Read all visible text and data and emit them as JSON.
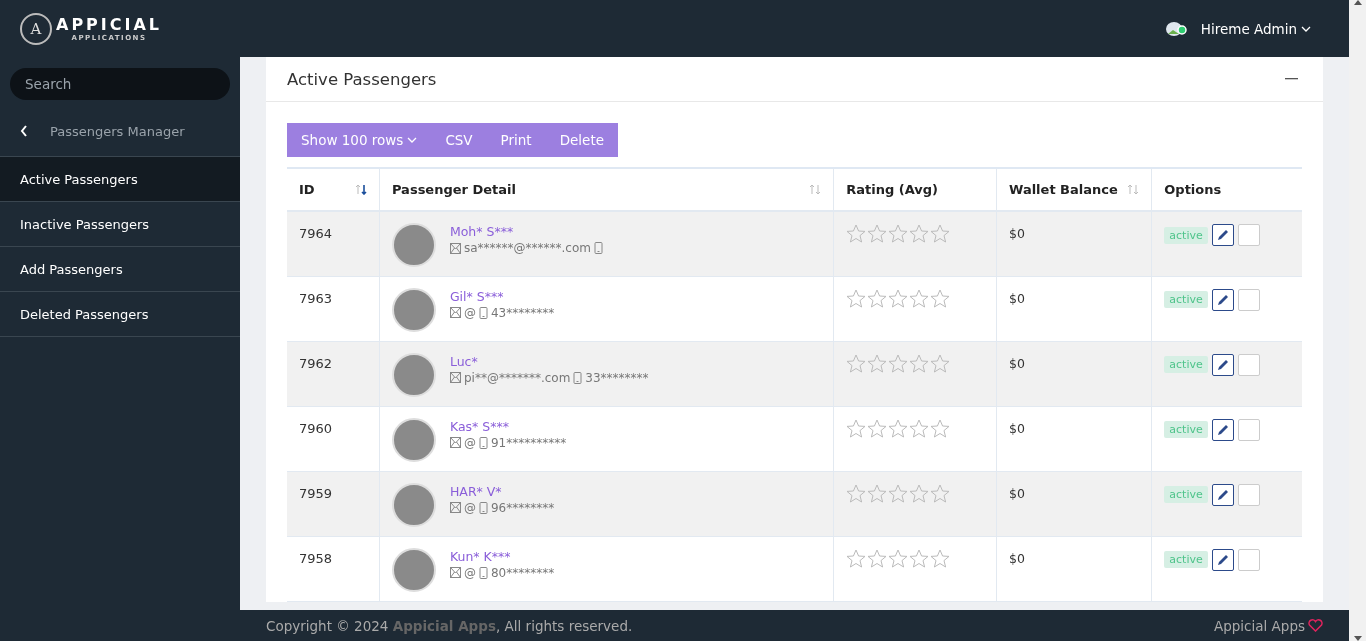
{
  "logo": {
    "mark": "A",
    "name": "APPICIAL",
    "tagline": "APPLICATIONS"
  },
  "user": {
    "name": "Hireme Admin"
  },
  "sidebar": {
    "search": {
      "placeholder": "Search"
    },
    "section": "Passengers Manager",
    "items": [
      {
        "label": "Active Passengers",
        "selected": true
      },
      {
        "label": "Inactive Passengers",
        "selected": false
      },
      {
        "label": "Add Passengers",
        "selected": false
      },
      {
        "label": "Deleted Passengers",
        "selected": false
      }
    ]
  },
  "card": {
    "title": "Active Passengers",
    "toolbar": [
      {
        "label": "Show 100 rows",
        "kind": "dropdown"
      },
      {
        "label": "CSV",
        "kind": "button"
      },
      {
        "label": "Print",
        "kind": "button"
      },
      {
        "label": "Delete",
        "kind": "button"
      }
    ]
  },
  "table": {
    "columns": [
      {
        "label": "ID",
        "sortable": true,
        "sorted": true
      },
      {
        "label": "Passenger Detail",
        "sortable": true,
        "sorted": false
      },
      {
        "label": "Rating (Avg)"
      },
      {
        "label": "Wallet Balance",
        "sortable": true,
        "sorted": false
      },
      {
        "label": "Options"
      }
    ],
    "rows": [
      {
        "id": "7964",
        "name": "Moh* S***",
        "email": "sa******@******.com",
        "stars": 0,
        "balance": "$0",
        "status": "active",
        "checked": false
      },
      {
        "id": "7963",
        "name": "Gil* S***",
        "email": "@",
        "phone": "43********",
        "stars": 0,
        "balance": "$0",
        "status": "active",
        "checked": false
      },
      {
        "id": "7962",
        "name": "Luc*",
        "email": "pi**@*******.com",
        "phone": "33********",
        "stars": 0,
        "balance": "$0",
        "status": "active",
        "checked": false
      },
      {
        "id": "7960",
        "name": "Kas* S***",
        "email": "@",
        "phone": "91**********",
        "stars": 0,
        "balance": "$0",
        "status": "active",
        "checked": false
      },
      {
        "id": "7959",
        "name": "HAR* V*",
        "email": "@",
        "phone": "96********",
        "stars": 0,
        "balance": "$0",
        "status": "active",
        "checked": false
      },
      {
        "id": "7958",
        "name": "Kun* K***",
        "email": "@",
        "phone": "80********",
        "stars": 0,
        "balance": "$0",
        "status": "active",
        "checked": false
      }
    ]
  },
  "footer": {
    "copyright": "Copyright © 2024 **Appicial Apps**, All rights reserved.",
    "brand": "Appicial Apps"
  }
}
